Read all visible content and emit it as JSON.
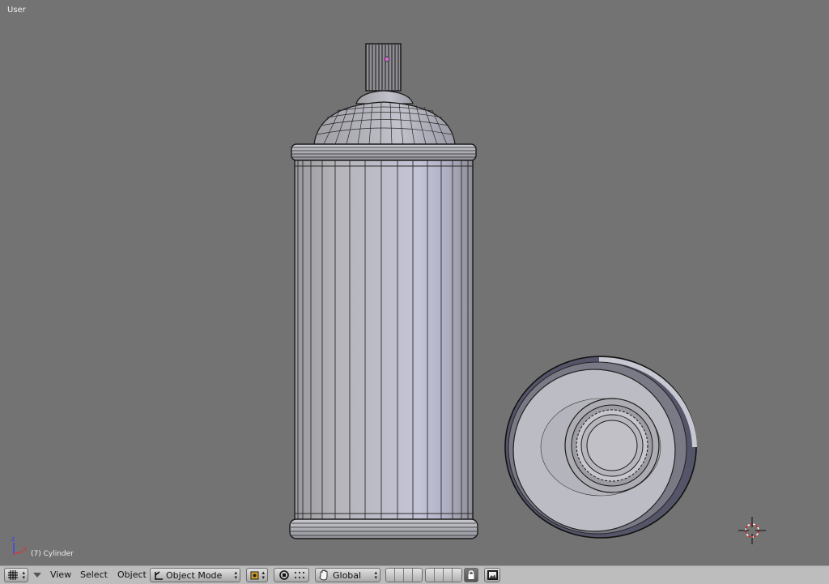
{
  "viewport": {
    "view_name": "User",
    "object_info": "(7) Cylinder",
    "background_color": "#737373",
    "axis_labels": {
      "z": "z",
      "x": "x"
    }
  },
  "header": {
    "editor_type_icon": "grid-icon",
    "menus": [
      "View",
      "Select",
      "Object"
    ],
    "mode": {
      "label": "Object Mode",
      "icon": "object-mode-icon"
    },
    "pivot_icon": "pivot-point-icon",
    "transform_orientation": {
      "label": "Global",
      "icon": "hand-icon"
    },
    "lock_icon": "lock-icon",
    "render_icon": "render-image-icon",
    "background_color": "#bdbdbd"
  }
}
